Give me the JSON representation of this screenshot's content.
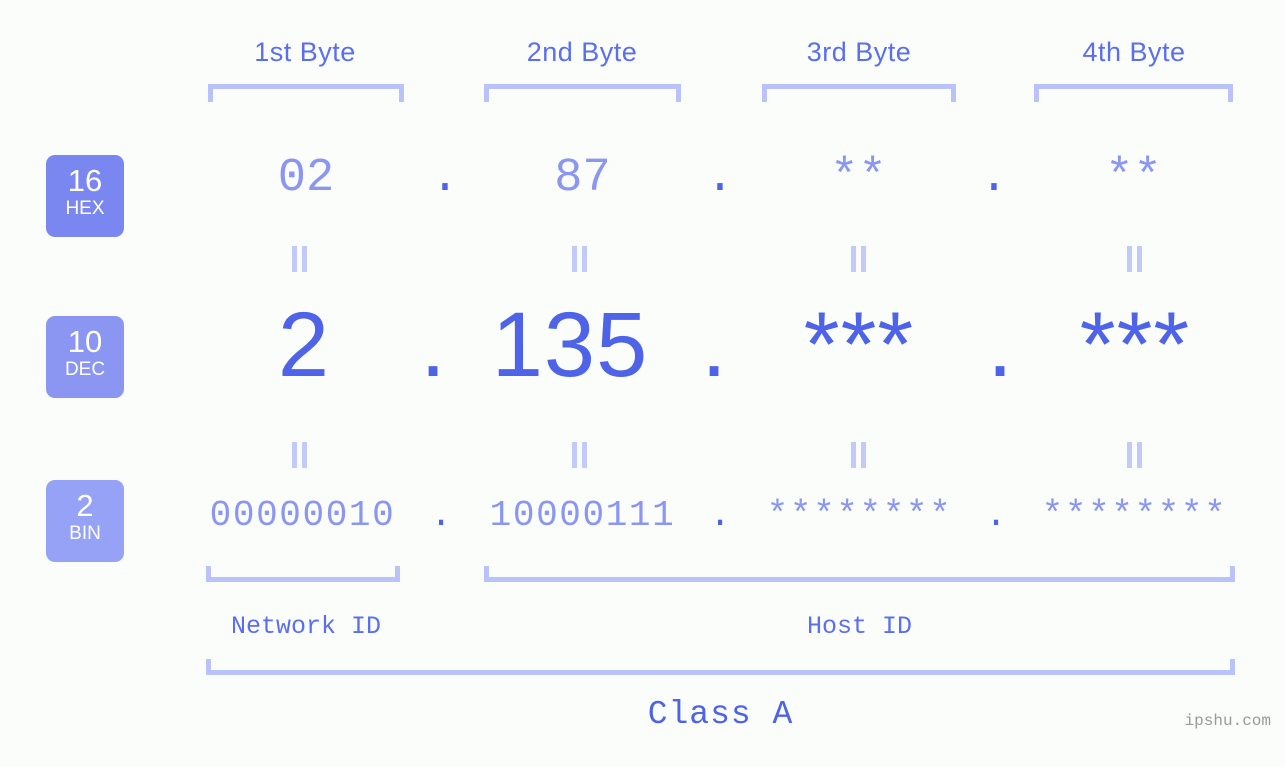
{
  "background_color": "#fbfdfa",
  "accent_colors": {
    "strong_blue": "#4e63e8",
    "mid_blue": "#5b6ef0",
    "light_blue": "#8a96f2",
    "pale_blue": "#b9c2fb",
    "badge_hex": "#7b87f0",
    "badge_dec": "#8a96f2",
    "badge_bin": "#95a2f5",
    "watermark_gray": "#9a9a9a"
  },
  "byte_headers": [
    {
      "label": "1st Byte"
    },
    {
      "label": "2nd Byte"
    },
    {
      "label": "3rd Byte"
    },
    {
      "label": "4th Byte"
    }
  ],
  "base_badges": [
    {
      "number": "16",
      "name": "HEX"
    },
    {
      "number": "10",
      "name": "DEC"
    },
    {
      "number": "2",
      "name": "BIN"
    }
  ],
  "rows": {
    "hex": {
      "base": "16",
      "base_name": "HEX",
      "octets": [
        "02",
        "87",
        "**",
        "**"
      ],
      "separator": "."
    },
    "dec": {
      "base": "10",
      "base_name": "DEC",
      "octets": [
        "2",
        "135",
        "***",
        "***"
      ],
      "separator": "."
    },
    "bin": {
      "base": "2",
      "base_name": "BIN",
      "octets": [
        "00000010",
        "10000111",
        "********",
        "********"
      ],
      "separator": "."
    }
  },
  "sections": {
    "network_id": "Network ID",
    "host_id": "Host ID",
    "class": "Class A"
  },
  "watermark": "ipshu.com"
}
